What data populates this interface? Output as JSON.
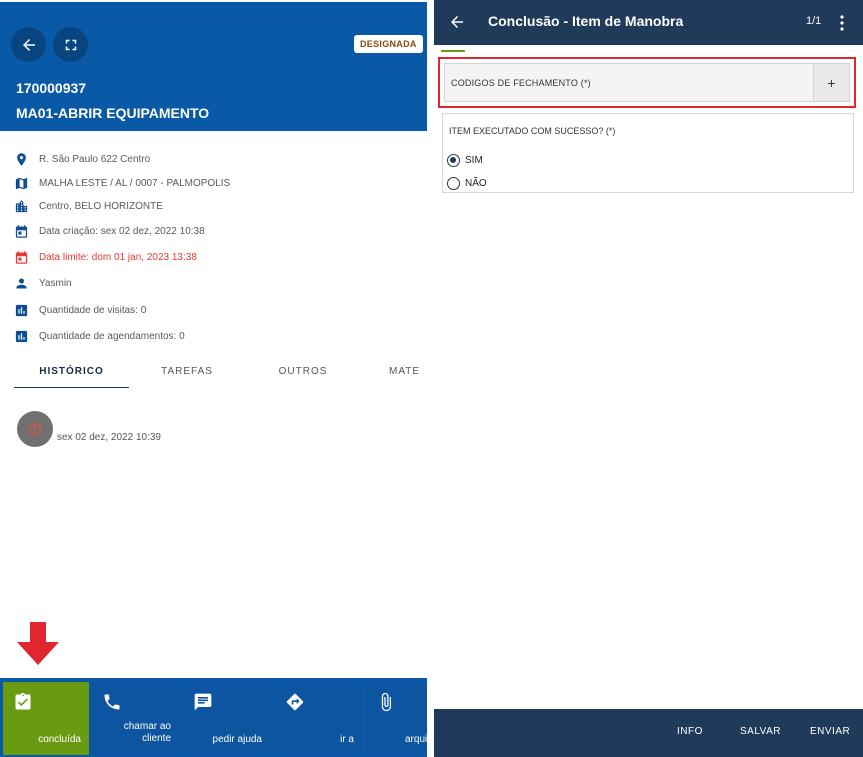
{
  "colors": {
    "left_header": "#0a59a6",
    "right_appbar": "#203a5a",
    "active_action": "#6a9a12",
    "deadline_red": "#e53935",
    "highlight_red": "#e0262e"
  },
  "left": {
    "badge": "DESIGNADA",
    "order_number": "170000937",
    "order_title": "MA01-ABRIR EQUIPAMENTO",
    "info": {
      "address": "R. São Paulo 622 Centro",
      "network": "MALHA LESTE / AL / 0007 - PALMOPOLIS",
      "district": "Centro, BELO HORIZONTE",
      "created": "Data criação: sex 02 dez, 2022 10:38",
      "deadline": "Data limite: dom 01 jan, 2023 13:38",
      "user": "Yasmin",
      "visits": "Quantidade de visitas: 0",
      "schedules": "Quantidade de agendamentos: 0"
    },
    "tabs": [
      "HISTÓRICO",
      "TAREFAS",
      "OUTROS",
      "MATE"
    ],
    "history": [
      {
        "date": "sex 02 dez, 2022 10:39"
      }
    ],
    "actions": {
      "done": "concluída",
      "call_line1": "chamar ao",
      "call_line2": "cliente",
      "help": "pedir ajuda",
      "goto": "ir a",
      "attach": "arqui"
    }
  },
  "right": {
    "title": "Conclusão - Item de Manobra",
    "pager": "1/1",
    "codes_label": "CODIGOS DE FECHAMENTO (*)",
    "codes_add": "+",
    "question": "ITEM EXECUTADO COM SUCESSO? (*)",
    "options": [
      "SIM",
      "NÃO"
    ],
    "selected_option": "SIM",
    "footer": {
      "info": "INFO",
      "save": "SALVAR",
      "send": "ENVIAR"
    }
  }
}
